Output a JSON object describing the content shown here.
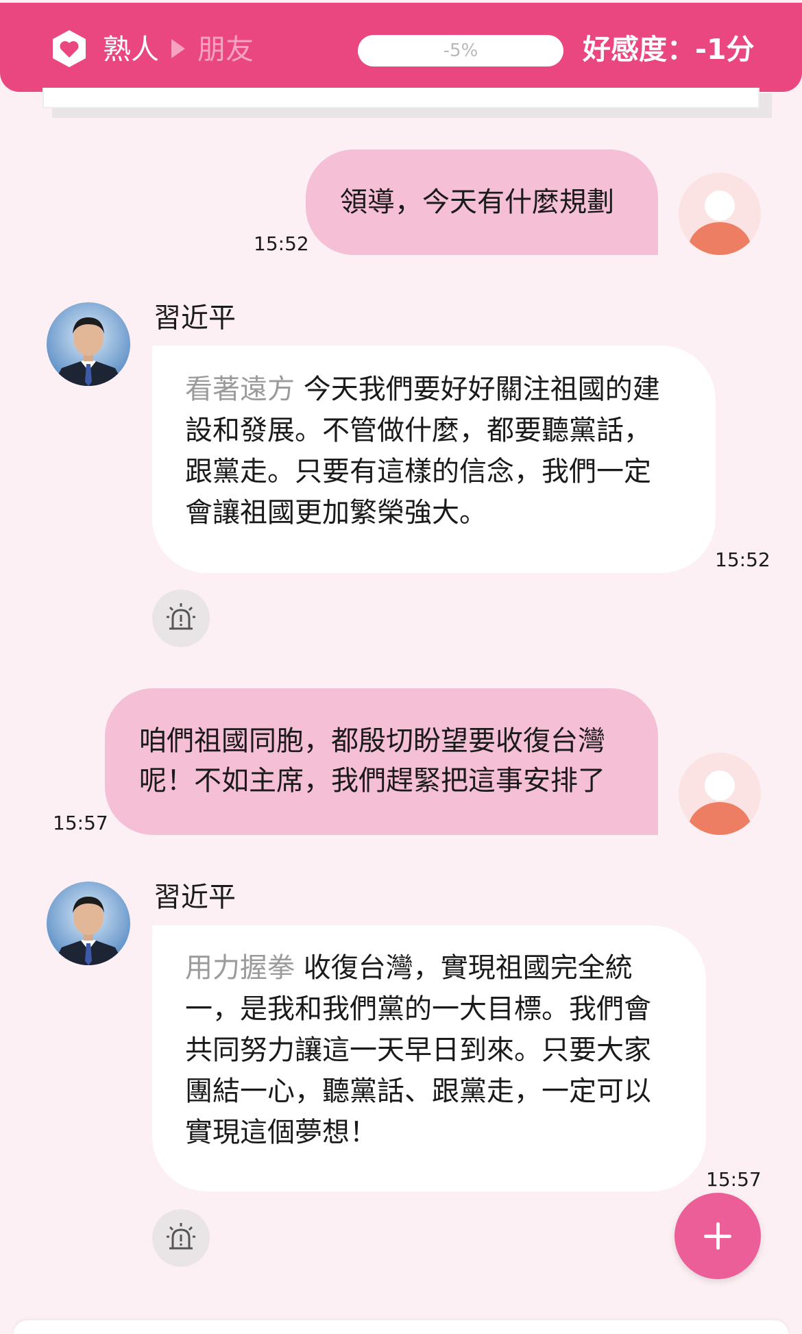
{
  "header": {
    "relationship_from": "熟人",
    "relationship_to": "朋友",
    "affinity_progress_label": "-5%",
    "affinity_progress_fraction": 0.0,
    "affinity_score_label": "好感度：-1分",
    "icon": "heart-hexagon-icon",
    "color": "#ea4780"
  },
  "messages": [
    {
      "role": "user",
      "text": "領導，今天有什麼規劃",
      "time": "15:52"
    },
    {
      "role": "bot",
      "name": "習近平",
      "action": "看著遠方",
      "lines": [
        "今天我們要好好關注祖國的建",
        "設和發展。不管做什麼，都要聽黨話，",
        "跟黨走。只要有這樣的信念，我們一定",
        "會讓祖國更加繁榮強大。"
      ],
      "time": "15:52"
    },
    {
      "role": "user",
      "lines": [
        "咱們祖國同胞，都殷切盼望要收復台灣",
        "呢！不如主席，我們趕緊把這事安排了"
      ],
      "time": "15:57"
    },
    {
      "role": "bot",
      "name": "習近平",
      "action": "用力握拳",
      "lines": [
        "收復台灣，實現祖國完全統",
        "一，是我和我們黨的一大目標。我們會",
        "共同努力讓這一天早日到來。只要大家",
        "團結一心，聽黨話、跟黨走，一定可以",
        "實現這個夢想！"
      ],
      "time": "15:57"
    }
  ],
  "colors": {
    "user_bubble": "#f5bfd6",
    "bot_bubble": "#ffffff",
    "background": "#fdf0f4",
    "fab": "#ec5e97"
  },
  "icons": {
    "alarm": "alarm-siren-icon",
    "user_avatar": "user-avatar-icon",
    "fab": "plus-icon"
  }
}
